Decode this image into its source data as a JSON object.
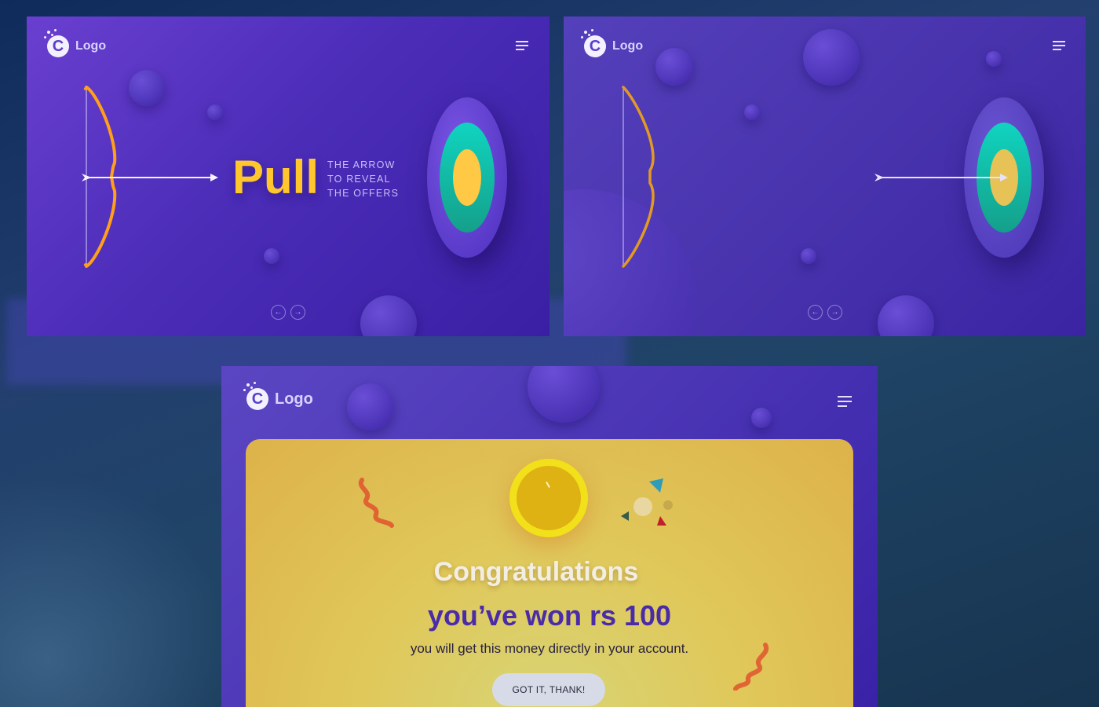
{
  "colors": {
    "accent_yellow": "#ffc72c",
    "purple": "#4b2db8",
    "teal": "#14b8a6",
    "won_text": "#4a2ca8",
    "card_gold": "#ddb24a"
  },
  "logo": {
    "text": "Logo",
    "icon": "c-logo-icon"
  },
  "screen1": {
    "pull_word": "Pull",
    "sub_lines": [
      "THE ARROW",
      "TO REVEAL",
      "THE OFFERS"
    ]
  },
  "nav": {
    "prev": "←",
    "next": "→"
  },
  "screen3": {
    "congrats": "Congratulations",
    "won": "you’ve won rs 100",
    "message": "you will get this money directly in your account.",
    "button": "GOT IT, THANK!"
  },
  "icons": [
    "menu-icon",
    "bow-icon",
    "arrow-icon",
    "target-icon",
    "coin-icon",
    "confetti-icon"
  ]
}
